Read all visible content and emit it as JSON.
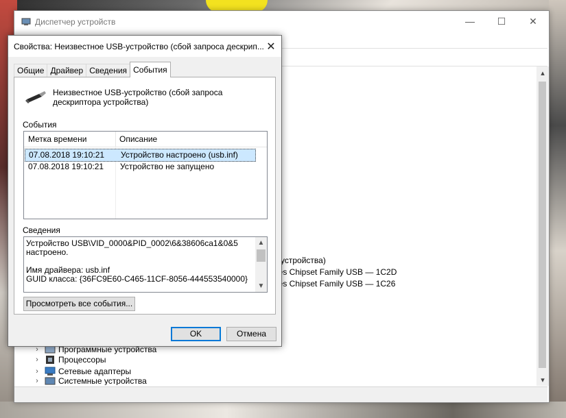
{
  "device_manager": {
    "title": "Диспетчер устройств",
    "controls": {
      "minimize": "—",
      "maximize": "☐",
      "close": "✕"
    },
    "partial_lines": [
      "а устройства)",
      "ries Chipset Family USB — 1C2D",
      "ries Chipset Family USB — 1C26"
    ],
    "tree_items": [
      {
        "label": "Программные устройства",
        "icon": "software-device-icon"
      },
      {
        "label": "Процессоры",
        "icon": "cpu-icon"
      },
      {
        "label": "Сетевые адаптеры",
        "icon": "network-adapter-icon"
      },
      {
        "label": "Системные устройства",
        "icon": "system-device-icon"
      }
    ]
  },
  "dialog": {
    "title": "Свойства: Неизвестное USB-устройство (сбой запроса дескрип...",
    "close": "✕",
    "tabs": [
      "Общие",
      "Драйвер",
      "Сведения",
      "События"
    ],
    "active_tab": "События",
    "device_name": "Неизвестное USB-устройство (сбой запроса дескриптора устройства)",
    "events_label": "События",
    "columns": {
      "time": "Метка времени",
      "desc": "Описание"
    },
    "events": [
      {
        "time": "07.08.2018 19:10:21",
        "desc": "Устройство настроено (usb.inf)",
        "selected": true
      },
      {
        "time": "07.08.2018 19:10:21",
        "desc": "Устройство не запущено",
        "selected": false
      }
    ],
    "details_label": "Сведения",
    "details_lines": [
      "Устройство USB\\VID_0000&PID_0002\\6&38606ca1&0&5",
      "настроено.",
      "",
      "Имя драйвера: usb.inf",
      "GUID класса: {36FC9E60-C465-11CF-8056-444553540000}"
    ],
    "buttons": {
      "view_all": "Просмотреть все события...",
      "ok": "OK",
      "cancel": "Отмена"
    }
  }
}
